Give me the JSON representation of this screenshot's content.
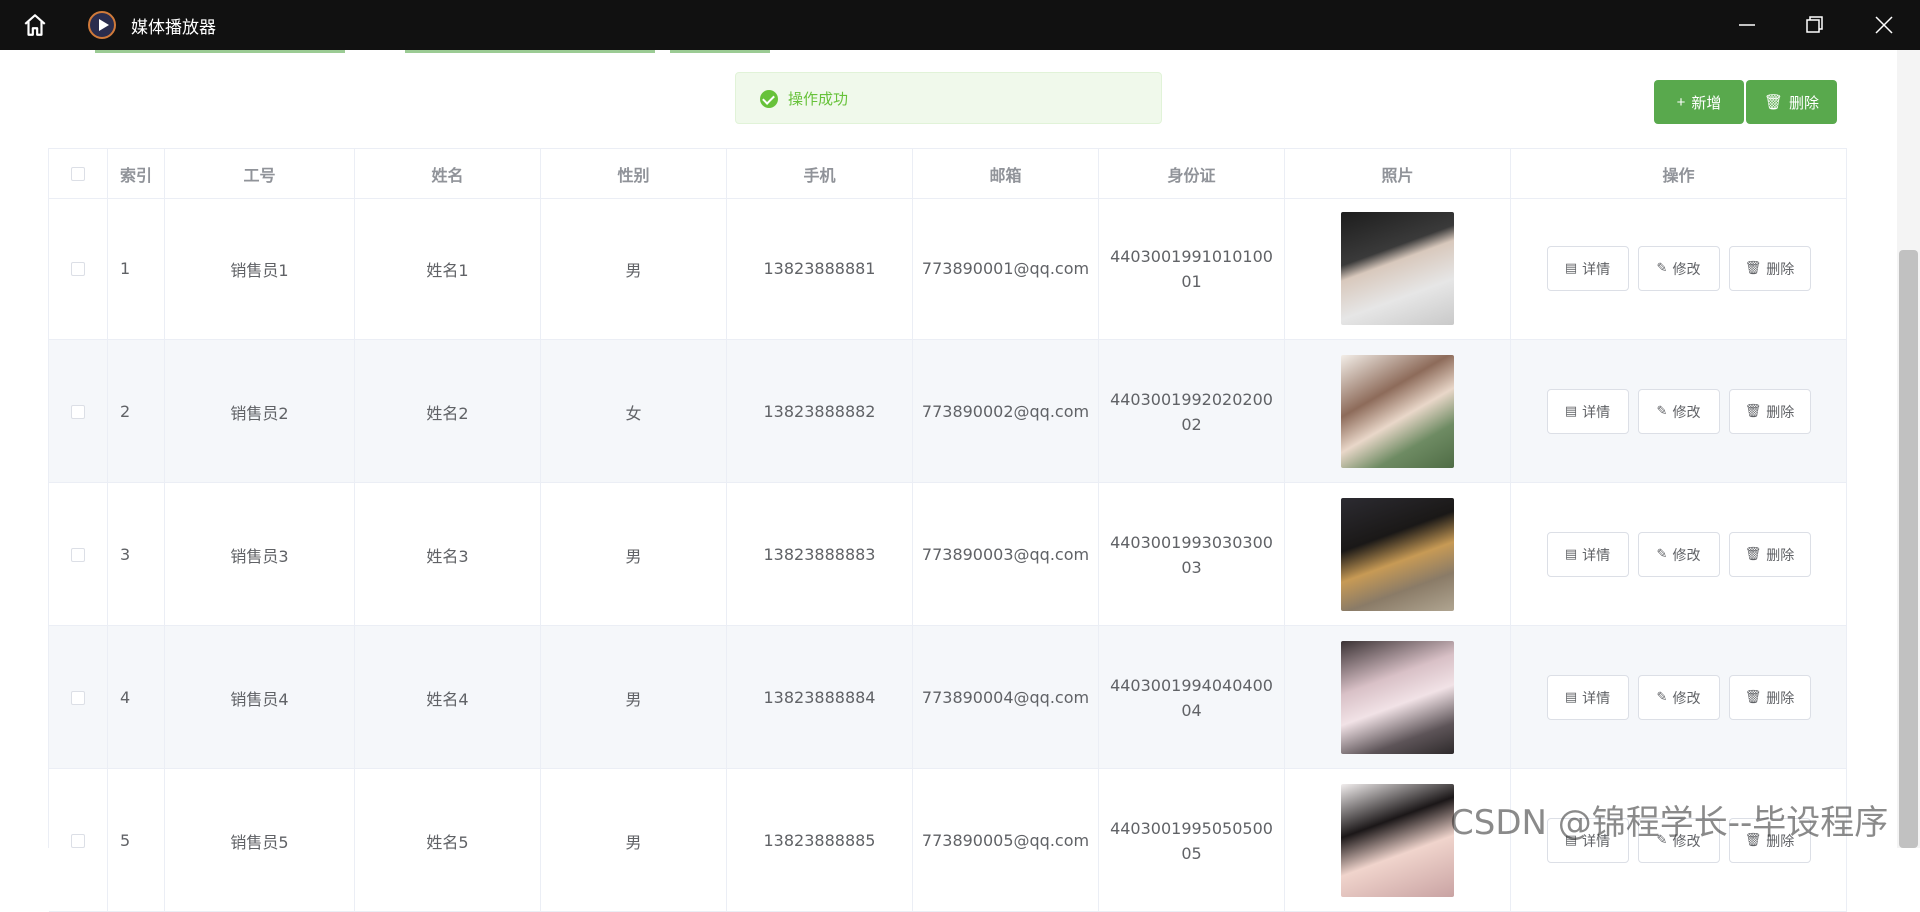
{
  "titlebar": {
    "app_title": "媒体播放器"
  },
  "colors": {
    "primary": "#59a94d",
    "success": "#67c23a",
    "titlebar": "#111111",
    "row_alt": "#f5f7fa"
  },
  "toast": {
    "text": "操作成功",
    "icon": "check-circle-icon"
  },
  "toolbar": {
    "add_label": "新增",
    "add_icon": "+",
    "delete_label": "删除",
    "delete_icon": "🗑"
  },
  "table": {
    "columns": [
      "",
      "索引",
      "工号",
      "姓名",
      "性别",
      "手机",
      "邮箱",
      "身份证",
      "照片",
      "操作"
    ],
    "action_labels": {
      "detail": "详情",
      "edit": "修改",
      "delete": "删除"
    },
    "action_icons": {
      "detail": "▤",
      "edit": "✎",
      "delete": "🗑"
    },
    "rows": [
      {
        "index": "1",
        "job_no": "销售员1",
        "name": "姓名1",
        "gender": "男",
        "phone": "13823888881",
        "email": "773890001@qq.com",
        "id_card": "440300199101010001"
      },
      {
        "index": "2",
        "job_no": "销售员2",
        "name": "姓名2",
        "gender": "女",
        "phone": "13823888882",
        "email": "773890002@qq.com",
        "id_card": "440300199202020002"
      },
      {
        "index": "3",
        "job_no": "销售员3",
        "name": "姓名3",
        "gender": "男",
        "phone": "13823888883",
        "email": "773890003@qq.com",
        "id_card": "440300199303030003"
      },
      {
        "index": "4",
        "job_no": "销售员4",
        "name": "姓名4",
        "gender": "男",
        "phone": "13823888884",
        "email": "773890004@qq.com",
        "id_card": "440300199404040004"
      },
      {
        "index": "5",
        "job_no": "销售员5",
        "name": "姓名5",
        "gender": "男",
        "phone": "13823888885",
        "email": "773890005@qq.com",
        "id_card": "440300199505050005"
      }
    ]
  },
  "watermark": "CSDN @锦程学长--毕设程序"
}
